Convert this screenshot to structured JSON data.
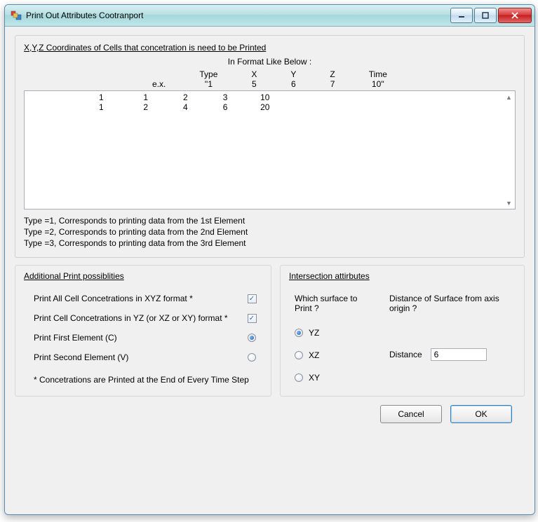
{
  "window": {
    "title": "Print Out Attributes Cootranport"
  },
  "top_group": {
    "title": "X,Y,Z Coordinates of Cells  that concetration is need to be Printed",
    "format_label": "In Format Like Below :",
    "header": {
      "type": "Type",
      "x": "X",
      "y": "Y",
      "z": "Z",
      "time": "Time"
    },
    "example": {
      "label": "e.x.",
      "type": "''1",
      "x": "5",
      "y": "6",
      "z": "7",
      "time": "10''"
    },
    "textarea_lines": [
      {
        "type": "1",
        "x": "1",
        "y": "2",
        "z": "3",
        "time": "10"
      },
      {
        "type": "1",
        "x": "2",
        "y": "4",
        "z": "6",
        "time": "20"
      }
    ],
    "notes": {
      "n1": "Type =1, Corresponds to printing data from the  1st   Element",
      "n2": "Type =2, Corresponds  to printing data from the 2nd  Element",
      "n3": "Type =3, Corresponds to printing data from the  3rd   Element"
    }
  },
  "additional": {
    "title": "Additional Print possiblities",
    "opt_all_xyz": "Print  All Cell Concetrations in  XYZ format *",
    "opt_yz": "Print  Cell Concetrations in   YZ (or XZ or XY) format *",
    "opt_first": "Print First Element (C)",
    "opt_second": "Print Second Element (V)",
    "footnote": "* Concetrations are Printed at the End of Every  Time Step",
    "check_xyz": true,
    "check_yz": true,
    "radio_element": "first"
  },
  "intersection": {
    "title": "Intersection attirbutes",
    "q_surface": "Which surface to Print ?",
    "q_distance": "Distance of Surface from axis origin ?",
    "surf_yz": "YZ",
    "surf_xz": "XZ",
    "surf_xy": "XY",
    "surface_selected": "YZ",
    "distance_label": "Distance",
    "distance_value": "6"
  },
  "buttons": {
    "cancel": "Cancel",
    "ok": "OK"
  }
}
